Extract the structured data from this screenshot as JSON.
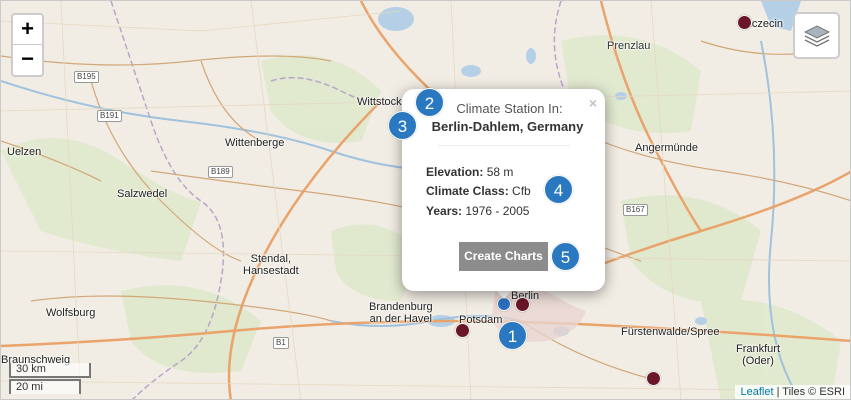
{
  "map": {
    "places": {
      "stettin": "Szczecin",
      "prenzlau": "Prenzlau",
      "wittstock": "Wittstock",
      "wittenberge": "Wittenberge",
      "uelzen": "Uelzen",
      "salzwedel": "Salzwedel",
      "stendal": "Stendal,\nHansestadt",
      "angermuende": "Angermünde",
      "brandenburg": "Brandenburg\nan der Havel",
      "potsdam": "Potsdam",
      "berlin": "Berlin",
      "wolfsburg": "Wolfsburg",
      "braunschweig": "Braunschweig",
      "fuerstenwalde": "Fürstenwalde/Spree",
      "frankfurt": "Frankfurt\n(Oder)"
    },
    "roads": {
      "b195": "B195",
      "b191": "B191",
      "b189": "B189",
      "b167": "B167",
      "b1": "B1"
    }
  },
  "controls": {
    "zoom_in": "+",
    "zoom_out": "−",
    "layers_icon": "layers-icon"
  },
  "scale": {
    "km": "30 km",
    "mi": "20 mi"
  },
  "attribution": {
    "leaflet": "Leaflet",
    "tiles": " | Tiles © ESRI"
  },
  "popup": {
    "close": "×",
    "heading": "Climate Station In:",
    "station": "Berlin-Dahlem, Germany",
    "elevation_label": "Elevation:",
    "elevation_value": " 58 m",
    "climate_label": "Climate Class:",
    "climate_value": " Cfb",
    "years_label": "Years:",
    "years_value": " 1976 - 2005",
    "button": "Create Charts"
  },
  "badges": {
    "b1": "1",
    "b2": "2",
    "b3": "3",
    "b4": "4",
    "b5": "5"
  },
  "colors": {
    "marker": "#6b1528",
    "active_marker": "#2c6fbe",
    "badge": "#2a79c0"
  }
}
